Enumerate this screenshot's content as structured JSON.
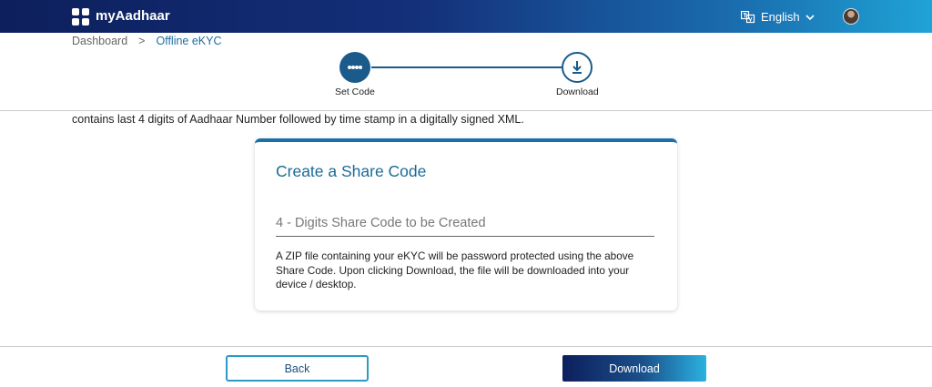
{
  "header": {
    "brand": "myAadhaar",
    "language": "English",
    "colors": {
      "gradient_start": "#0d1f5c",
      "gradient_end": "#1fa3d6"
    }
  },
  "breadcrumb": {
    "home": "Dashboard",
    "separator": ">",
    "current": "Offline eKYC"
  },
  "stepper": {
    "steps": [
      {
        "label": "Set Code"
      },
      {
        "label": "Download"
      }
    ]
  },
  "info_text": "contains last 4 digits of Aadhaar Number followed by time stamp in a digitally signed XML.",
  "card": {
    "title": "Create a Share Code",
    "field_placeholder": "4 - Digits Share Code to be Created",
    "description": "A ZIP file containing your eKYC will be password protected using the above Share Code. Upon clicking Download, the file will be downloaded into your device / desktop."
  },
  "footer": {
    "back_label": "Back",
    "download_label": "Download"
  },
  "icons": {
    "logo": "grid-logo-icon",
    "language": "translate-icon",
    "language_chevron": "chevron-down-icon",
    "step1": "dots-icon",
    "step2": "download-icon"
  }
}
